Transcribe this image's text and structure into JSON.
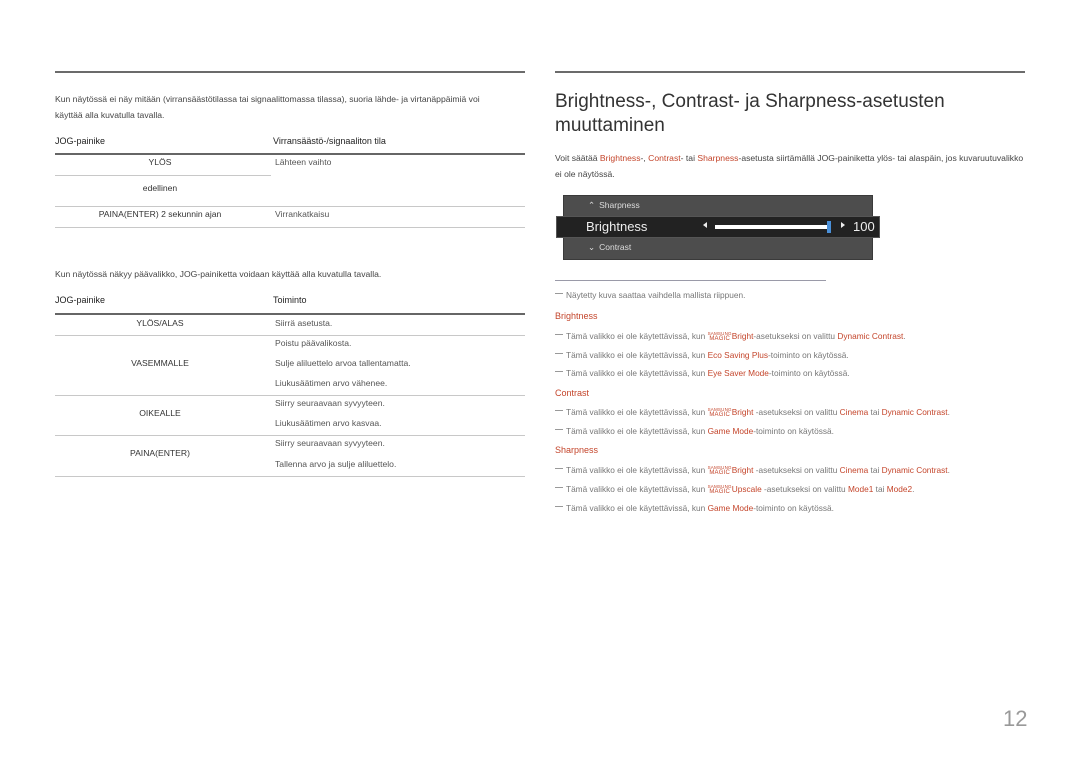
{
  "left": {
    "intro1": "Kun näytössä ei näy mitään (virransäästötilassa tai signaalittomassa tilassa), suoria lähde- ja virtanäppäimiä voi käyttää alla kuvatulla tavalla.",
    "table1": {
      "headers": [
        "JOG-painike",
        "Virransäästö-/signaaliton tila"
      ],
      "rows": [
        {
          "button": "YLÖS",
          "action": "Lähteen vaihto"
        },
        {
          "button": "edellinen",
          "action": ""
        },
        {
          "button": "PAINA(ENTER) 2 sekunnin ajan",
          "action": "Virrankatkaisu"
        }
      ]
    },
    "intro2": "Kun näytössä näkyy päävalikko, JOG-painiketta voidaan käyttää alla kuvatulla tavalla.",
    "table2": {
      "headers": [
        "JOG-painike",
        "Toiminto"
      ],
      "rows": [
        {
          "button": "YLÖS/ALAS",
          "actions": [
            "Siirrä asetusta."
          ]
        },
        {
          "button": "VASEMMALLE",
          "actions": [
            "Poistu päävalikosta.",
            "Sulje aliluettelo arvoa tallentamatta.",
            "Liukusäätimen arvo vähenee."
          ]
        },
        {
          "button": "OIKEALLE",
          "actions": [
            "Siirry seuraavaan syvyyteen.",
            "Liukusäätimen arvo kasvaa."
          ]
        },
        {
          "button": "PAINA(ENTER)",
          "actions": [
            "Siirry seuraavaan syvyyteen.",
            "Tallenna arvo ja sulje aliluettelo."
          ]
        }
      ]
    }
  },
  "right": {
    "title": "Brightness-, Contrast- ja Sharpness-asetusten muuttaminen",
    "intro": {
      "p1": "Voit säätää ",
      "a1": "Brightness",
      "p2": "-, ",
      "a2": "Contrast",
      "p3": "- tai ",
      "a3": "Sharpness",
      "p4": "-asetusta siirtämällä JOG-painiketta ylös- tai alaspäin, jos kuvaruutuvalikko ei ole näytössä."
    },
    "osd": {
      "above_label": "Sharpness",
      "current_label": "Brightness",
      "below_label": "Contrast",
      "value": "100",
      "value_fraction": 1.0,
      "accent": "#4a90d9"
    },
    "note_general": "Näytetty kuva saattaa vaihdella mallista riippuen.",
    "magic_top": "SAMSUNG",
    "magic_bottom": "MAGIC",
    "sections": {
      "brightness": {
        "title": "Brightness",
        "n1": {
          "t1": "Tämä valikko ei ole käytettävissä, kun ",
          "a1": "Bright",
          "t2": "-asetukseksi on valittu ",
          "a2": "Dynamic Contrast",
          "t3": "."
        },
        "n2": {
          "t1": "Tämä valikko ei ole käytettävissä, kun ",
          "a1": "Eco Saving Plus",
          "t2": "-toiminto on käytössä."
        },
        "n3": {
          "t1": "Tämä valikko ei ole käytettävissä, kun ",
          "a1": "Eye Saver Mode",
          "t2": "-toiminto on käytössä."
        }
      },
      "contrast": {
        "title": "Contrast",
        "n1": {
          "t1": "Tämä valikko ei ole käytettävissä, kun ",
          "a1": "Bright",
          "t2": " -asetukseksi on valittu ",
          "a2": "Cinema",
          "t3": " tai ",
          "a3": "Dynamic Contrast",
          "t4": "."
        },
        "n2": {
          "t1": "Tämä valikko ei ole käytettävissä, kun ",
          "a1": "Game Mode",
          "t2": "-toiminto on käytössä."
        }
      },
      "sharpness": {
        "title": "Sharpness",
        "n1": {
          "t1": "Tämä valikko ei ole käytettävissä, kun ",
          "a1": "Bright",
          "t2": " -asetukseksi on valittu ",
          "a2": "Cinema",
          "t3": " tai ",
          "a3": "Dynamic Contrast",
          "t4": "."
        },
        "n2": {
          "t1": "Tämä valikko ei ole käytettävissä, kun ",
          "a1": "Upscale",
          "t2": " -asetukseksi on valittu ",
          "a2": "Mode1",
          "t3": " tai ",
          "a3": "Mode2",
          "t4": "."
        },
        "n3": {
          "t1": "Tämä valikko ei ole käytettävissä, kun ",
          "a1": "Game Mode",
          "t2": "-toiminto on käytössä."
        }
      }
    }
  },
  "page_number": "12"
}
